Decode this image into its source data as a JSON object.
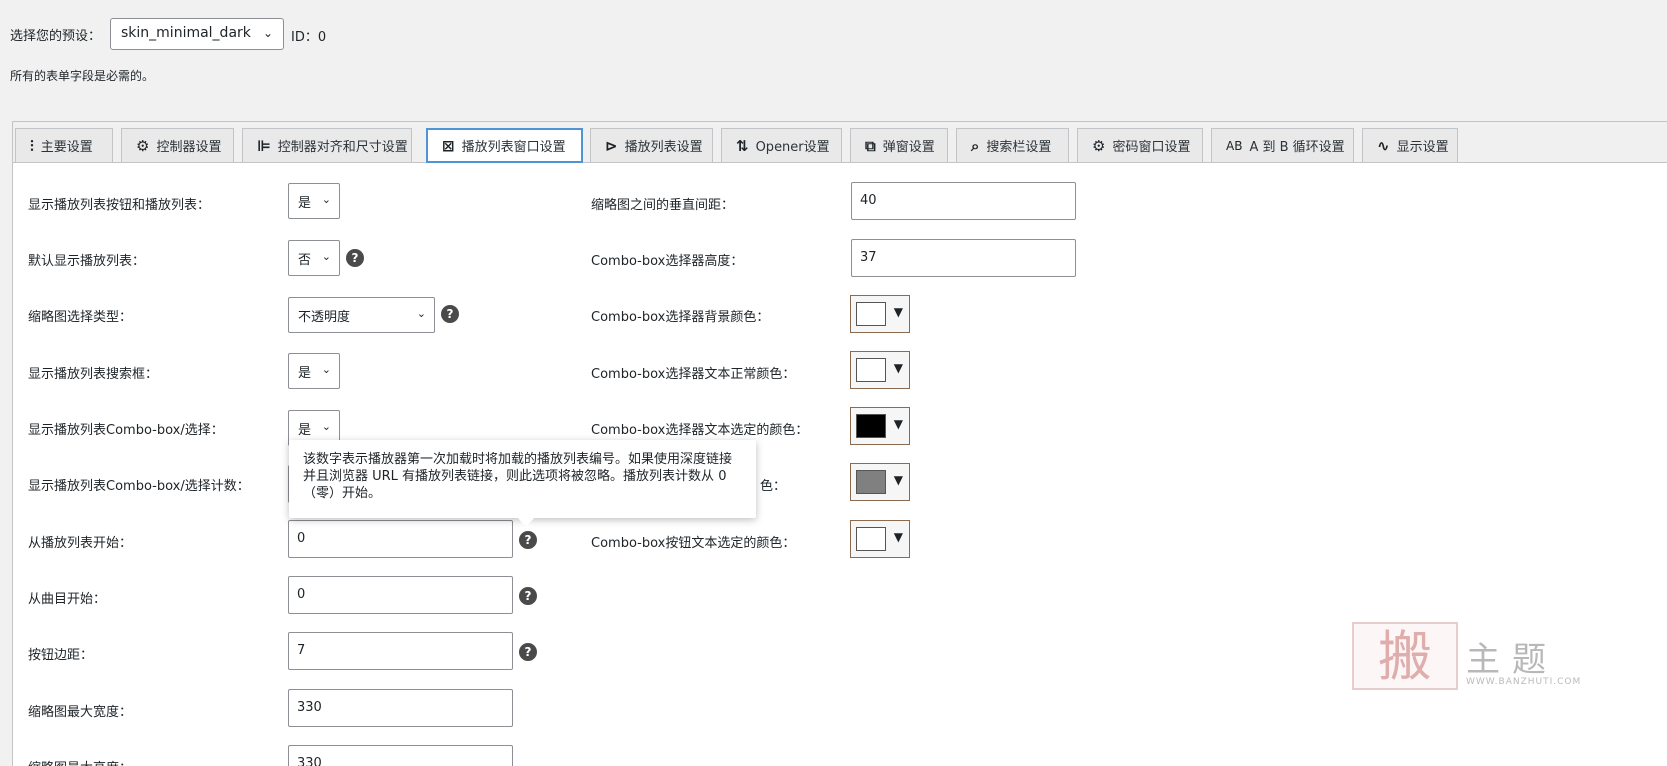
{
  "preset": {
    "label": "选择您的预设：",
    "value": "skin_minimal_dark",
    "id_text": "ID：0"
  },
  "required_note": "所有的表单字段是必需的。",
  "tabs": [
    {
      "label": "主要设置",
      "icon": "sliders-icon",
      "glyph": "⫶"
    },
    {
      "label": "控制器设置",
      "icon": "gear-icon",
      "glyph": "⚙"
    },
    {
      "label": "控制器对齐和尺寸设置",
      "icon": "align-icon",
      "glyph": "⊫"
    },
    {
      "label": "播放列表窗口设置",
      "icon": "playlist-window-icon",
      "glyph": "⊠"
    },
    {
      "label": "播放列表设置",
      "icon": "playlist-icon",
      "glyph": "⊳"
    },
    {
      "label": "Opener设置",
      "icon": "sort-arrows-icon",
      "glyph": "⇅"
    },
    {
      "label": "弹窗设置",
      "icon": "popup-icon",
      "glyph": "⧉"
    },
    {
      "label": "搜索栏设置",
      "icon": "search-bar-icon",
      "glyph": "⌕"
    },
    {
      "label": "密码窗口设置",
      "icon": "gear-icon",
      "glyph": "⚙"
    },
    {
      "label": "A 到 B 循环设置",
      "icon": "ab-loop-icon",
      "glyph": "AB"
    },
    {
      "label": "显示设置",
      "icon": "waveform-icon",
      "glyph": "∿"
    }
  ],
  "left_fields": [
    {
      "label": "显示播放列表按钮和播放列表：",
      "type": "select",
      "value": "是"
    },
    {
      "label": "默认显示播放列表：",
      "type": "select",
      "value": "否"
    },
    {
      "label": "缩略图选择类型：",
      "type": "select",
      "value": "不透明度"
    },
    {
      "label": "显示播放列表搜索框：",
      "type": "select",
      "value": "是"
    },
    {
      "label": "显示播放列表Combo-box/选择：",
      "type": "select",
      "value": "是"
    },
    {
      "label": "显示播放列表Combo-box/选择计数：",
      "type": "input",
      "value": ""
    },
    {
      "label": "从播放列表开始：",
      "type": "input",
      "value": "0"
    },
    {
      "label": "从曲目开始：",
      "type": "input",
      "value": "0"
    },
    {
      "label": "按钮边距：",
      "type": "input",
      "value": "7"
    },
    {
      "label": "缩略图最大宽度：",
      "type": "input",
      "value": "330"
    },
    {
      "label": "缩略图最大高度：",
      "type": "input",
      "value": "330"
    }
  ],
  "right_fields": [
    {
      "label": "缩略图之间的垂直间距：",
      "type": "input",
      "value": "40"
    },
    {
      "label": "Combo-box选择器高度：",
      "type": "input",
      "value": "37"
    },
    {
      "label": "Combo-box选择器背景颜色：",
      "type": "color",
      "value": "#ffffff"
    },
    {
      "label": "Combo-box选择器文本正常颜色：",
      "type": "color",
      "value": "#ffffff"
    },
    {
      "label": "Combo-box选择器文本选定的颜色：",
      "type": "color",
      "value": "#000000"
    },
    {
      "label": "色：",
      "type": "color",
      "value": "#808080"
    },
    {
      "label": "Combo-box按钮文本选定的颜色：",
      "type": "color",
      "value": "#ffffff"
    }
  ],
  "help_glyph": "?",
  "dropdown_glyph": "▼",
  "chevron_glyph": "⌄",
  "tooltip": {
    "line1": "该数字表示播放器第一次加载时将加载的播放列表编号。如果使用深度链接",
    "line2": "并且浏览器 URL 有播放列表链接，则此选项将被忽略。播放列表计数从 0",
    "line3": "（零）开始。"
  },
  "watermark": {
    "seal": "搬",
    "title": "主题",
    "url": "WWW.BANZHUTI.COM"
  }
}
